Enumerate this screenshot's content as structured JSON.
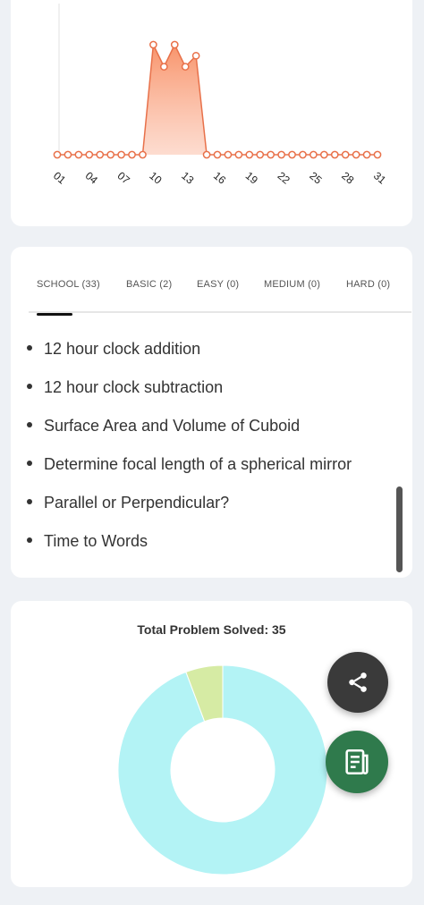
{
  "line_chart": {
    "x_tick_labels": [
      "01",
      "04",
      "07",
      "10",
      "13",
      "16",
      "19",
      "22",
      "25",
      "28",
      "31"
    ],
    "colors": {
      "stroke": "#e8714a",
      "fill": "#fbb9a0"
    }
  },
  "chart_data": [
    {
      "type": "area",
      "x": [
        1,
        2,
        3,
        4,
        5,
        6,
        7,
        8,
        9,
        10,
        11,
        12,
        13,
        14,
        15,
        16,
        17,
        18,
        19,
        20,
        21,
        22,
        23,
        24,
        25,
        26,
        27,
        28,
        29,
        30,
        31
      ],
      "series": [
        {
          "values": [
            0,
            0,
            0,
            0,
            0,
            0,
            0,
            0,
            0,
            5,
            4,
            5,
            4,
            4.5,
            0,
            0,
            0,
            0,
            0,
            0,
            0,
            0,
            0,
            0,
            0,
            0,
            0,
            0,
            0,
            0,
            0
          ]
        }
      ],
      "xticks": [
        "01",
        "04",
        "07",
        "10",
        "13",
        "16",
        "19",
        "22",
        "25",
        "28",
        "31"
      ],
      "grid": false
    },
    {
      "type": "pie",
      "title": "Total Problem Solved: 35",
      "labels": [
        "SCHOOL",
        "BASIC"
      ],
      "values": [
        33,
        2
      ],
      "colors": [
        "#b3f3f5",
        "#d6eba4"
      ],
      "donut": true
    }
  ],
  "tabs": [
    {
      "label": "SCHOOL (33)",
      "active": true
    },
    {
      "label": "BASIC (2)",
      "active": false
    },
    {
      "label": "EASY (0)",
      "active": false
    },
    {
      "label": "MEDIUM (0)",
      "active": false
    },
    {
      "label": "HARD (0)",
      "active": false
    }
  ],
  "problems": [
    "12 hour clock addition",
    "12 hour clock subtraction",
    "Surface Area and Volume of Cuboid",
    "Determine focal length of a spherical mirror",
    "Parallel or Perpendicular?",
    "Time to Words"
  ],
  "pie_card": {
    "title": "Total Problem Solved: 35"
  },
  "fabs": {
    "share_icon": "share-icon",
    "notes_icon": "notes-icon"
  }
}
